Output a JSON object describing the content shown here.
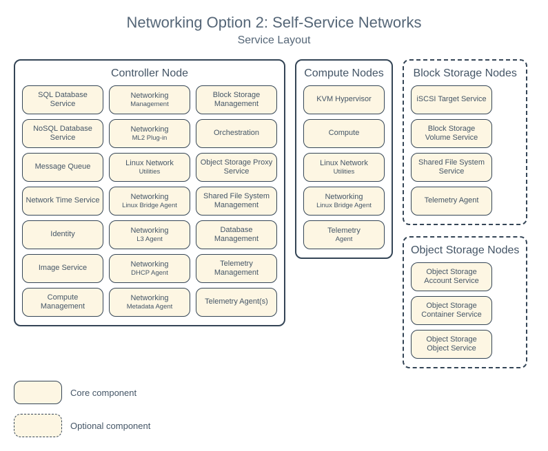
{
  "title": "Networking Option 2: Self-Service Networks",
  "subtitle": "Service Layout",
  "controller": {
    "title": "Controller Node",
    "col1": [
      "SQL Database Service",
      "NoSQL Database Service",
      "Message Queue",
      "Network Time Service",
      "Identity",
      "Image Service",
      "Compute Management"
    ],
    "col2": [
      {
        "l1": "Networking",
        "l2": "Management"
      },
      {
        "l1": "Networking",
        "l2": "ML2 Plug-in"
      },
      {
        "l1": "Linux Network",
        "l2": "Utilities"
      },
      {
        "l1": "Networking",
        "l2": "Linux Bridge Agent"
      },
      {
        "l1": "Networking",
        "l2": "L3 Agent"
      },
      {
        "l1": "Networking",
        "l2": "DHCP Agent"
      },
      {
        "l1": "Networking",
        "l2": "Metadata Agent"
      }
    ],
    "col3": [
      "Block Storage Management",
      "Orchestration",
      "Object Storage Proxy Service",
      "Shared File System Management",
      "Database Management",
      "Telemetry Management",
      "Telemetry Agent(s)"
    ]
  },
  "compute": {
    "title": "Compute Nodes",
    "items": [
      {
        "l1": "KVM Hypervisor"
      },
      {
        "l1": "Compute"
      },
      {
        "l1": "Linux Network",
        "l2": "Utilities"
      },
      {
        "l1": "Networking",
        "l2": "Linux Bridge Agent"
      },
      {
        "l1": "Telemetry",
        "l2": "Agent"
      }
    ]
  },
  "blockstorage": {
    "title": "Block Storage Nodes",
    "items": [
      "iSCSI Target Service",
      "Block Storage Volume Service",
      "Shared File System Service",
      "Telemetry Agent"
    ]
  },
  "objectstorage": {
    "title": "Object Storage Nodes",
    "items": [
      "Object Storage Account Service",
      "Object Storage Container Service",
      "Object Storage Object Service"
    ]
  },
  "legend": {
    "core": "Core component",
    "optional": "Optional component"
  }
}
